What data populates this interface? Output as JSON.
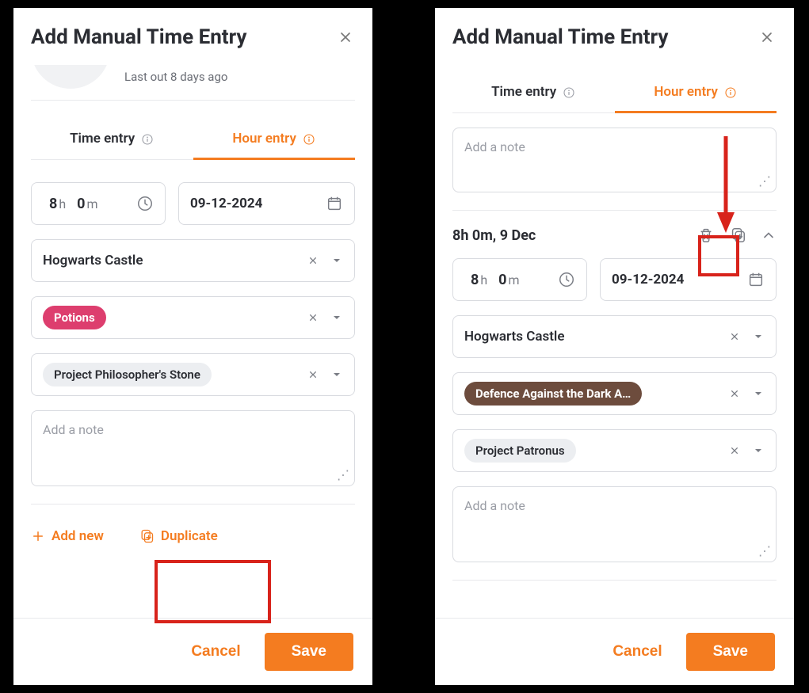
{
  "left": {
    "title": "Add Manual Time Entry",
    "lastout": "Last out 8 days ago",
    "tabs": {
      "time": "Time entry",
      "hour": "Hour entry",
      "active": "hour"
    },
    "hours": "8",
    "hours_unit": "h",
    "minutes": "0",
    "minutes_unit": "m",
    "date": "09-12-2024",
    "location": "Hogwarts Castle",
    "category_chip": "Potions",
    "project_chip": "Project Philosopher's Stone",
    "note_placeholder": "Add a note",
    "add_new": "Add new",
    "duplicate": "Duplicate",
    "cancel": "Cancel",
    "save": "Save"
  },
  "right": {
    "title": "Add Manual Time Entry",
    "tabs": {
      "time": "Time entry",
      "hour": "Hour entry",
      "active": "hour"
    },
    "note_placeholder_top": "Add a note",
    "summary": "8h 0m, 9 Dec",
    "hours": "8",
    "hours_unit": "h",
    "minutes": "0",
    "minutes_unit": "m",
    "date": "09-12-2024",
    "location": "Hogwarts Castle",
    "category_chip": "Defence Against the Dark A…",
    "project_chip": "Project Patronus",
    "note_placeholder": "Add a note",
    "cancel": "Cancel",
    "save": "Save"
  }
}
